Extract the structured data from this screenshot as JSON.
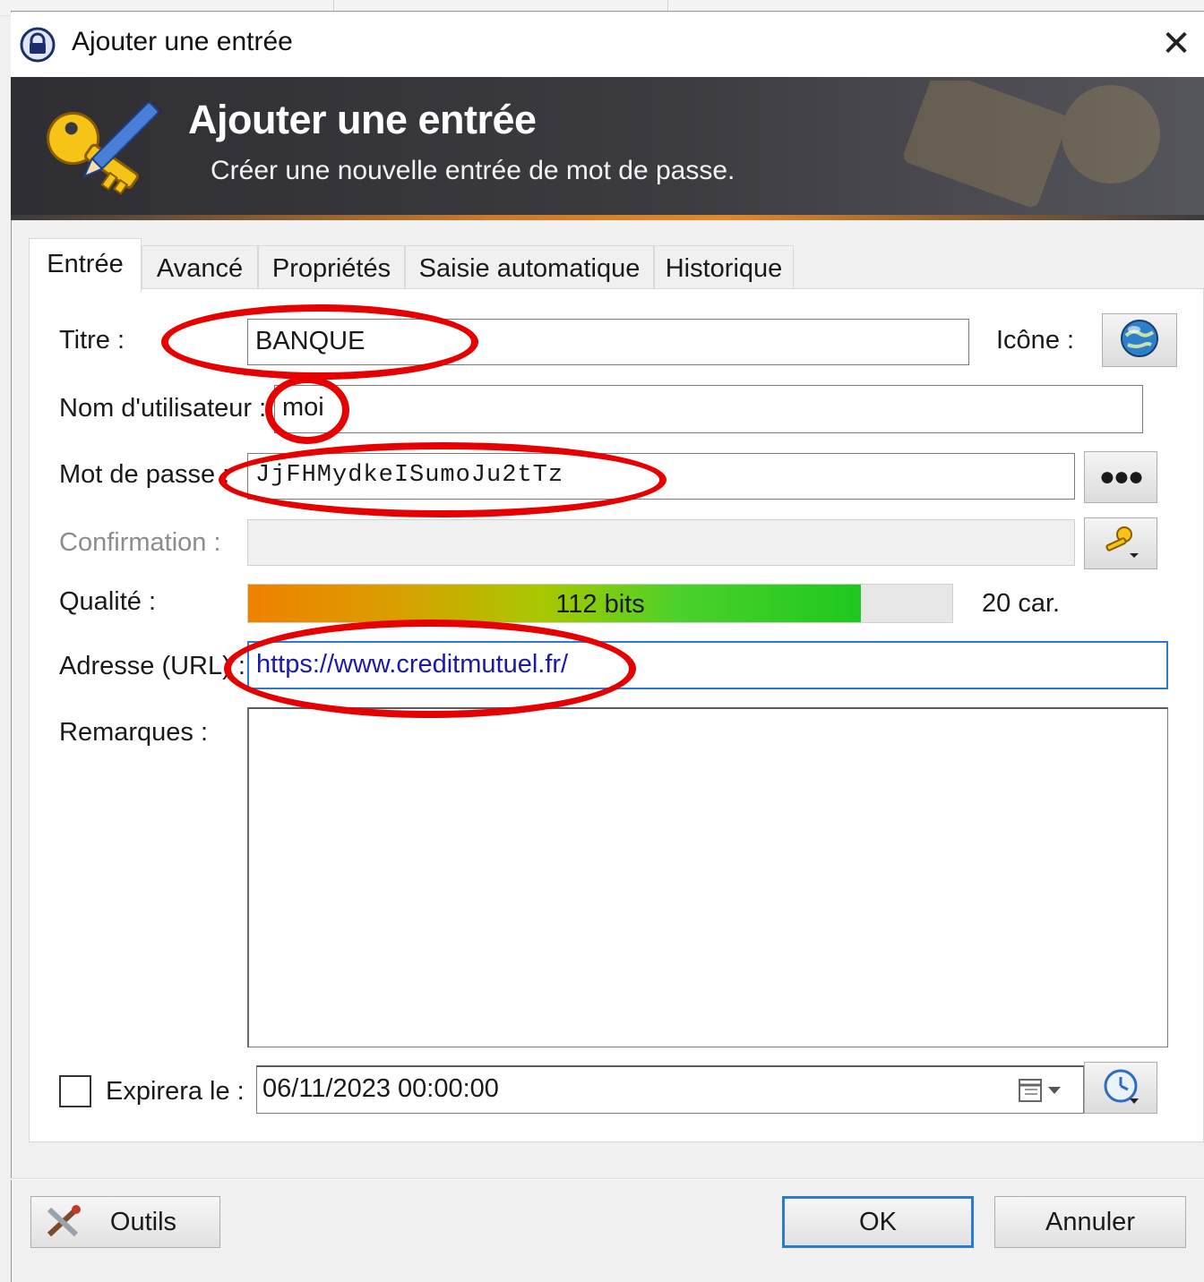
{
  "window": {
    "title": "Ajouter une entrée",
    "close_icon": "close-icon"
  },
  "banner": {
    "title": "Ajouter une entrée",
    "subtitle": "Créer une nouvelle entrée de mot de passe."
  },
  "tabs": [
    {
      "label": "Entrée",
      "active": true
    },
    {
      "label": "Avancé"
    },
    {
      "label": "Propriétés"
    },
    {
      "label": "Saisie automatique"
    },
    {
      "label": "Historique"
    }
  ],
  "form": {
    "title_label": "Titre :",
    "title_value": "BANQUE",
    "icon_label": "Icône :",
    "username_label": "Nom d'utilisateur :",
    "username_value": "moi",
    "password_label": "Mot de passe :",
    "password_value": "JjFHMydkeISumoJu2tTz",
    "confirm_label": "Confirmation :",
    "quality_label": "Qualité :",
    "quality_text": "112 bits",
    "quality_fraction": 0.87,
    "char_count": "20 car.",
    "url_label": "Adresse (URL) :",
    "url_value": "https://www.creditmutuel.fr/",
    "notes_label": "Remarques :",
    "notes_value": "",
    "expire_label": "Expirera le :",
    "expire_checked": false,
    "expire_value": "06/11/2023 00:00:00"
  },
  "buttons": {
    "tools": "Outils",
    "ok": "OK",
    "cancel": "Annuler"
  },
  "colors": {
    "annotation": "#e60000",
    "focus": "#2b7bd1",
    "url_text": "#1a1aa8"
  }
}
